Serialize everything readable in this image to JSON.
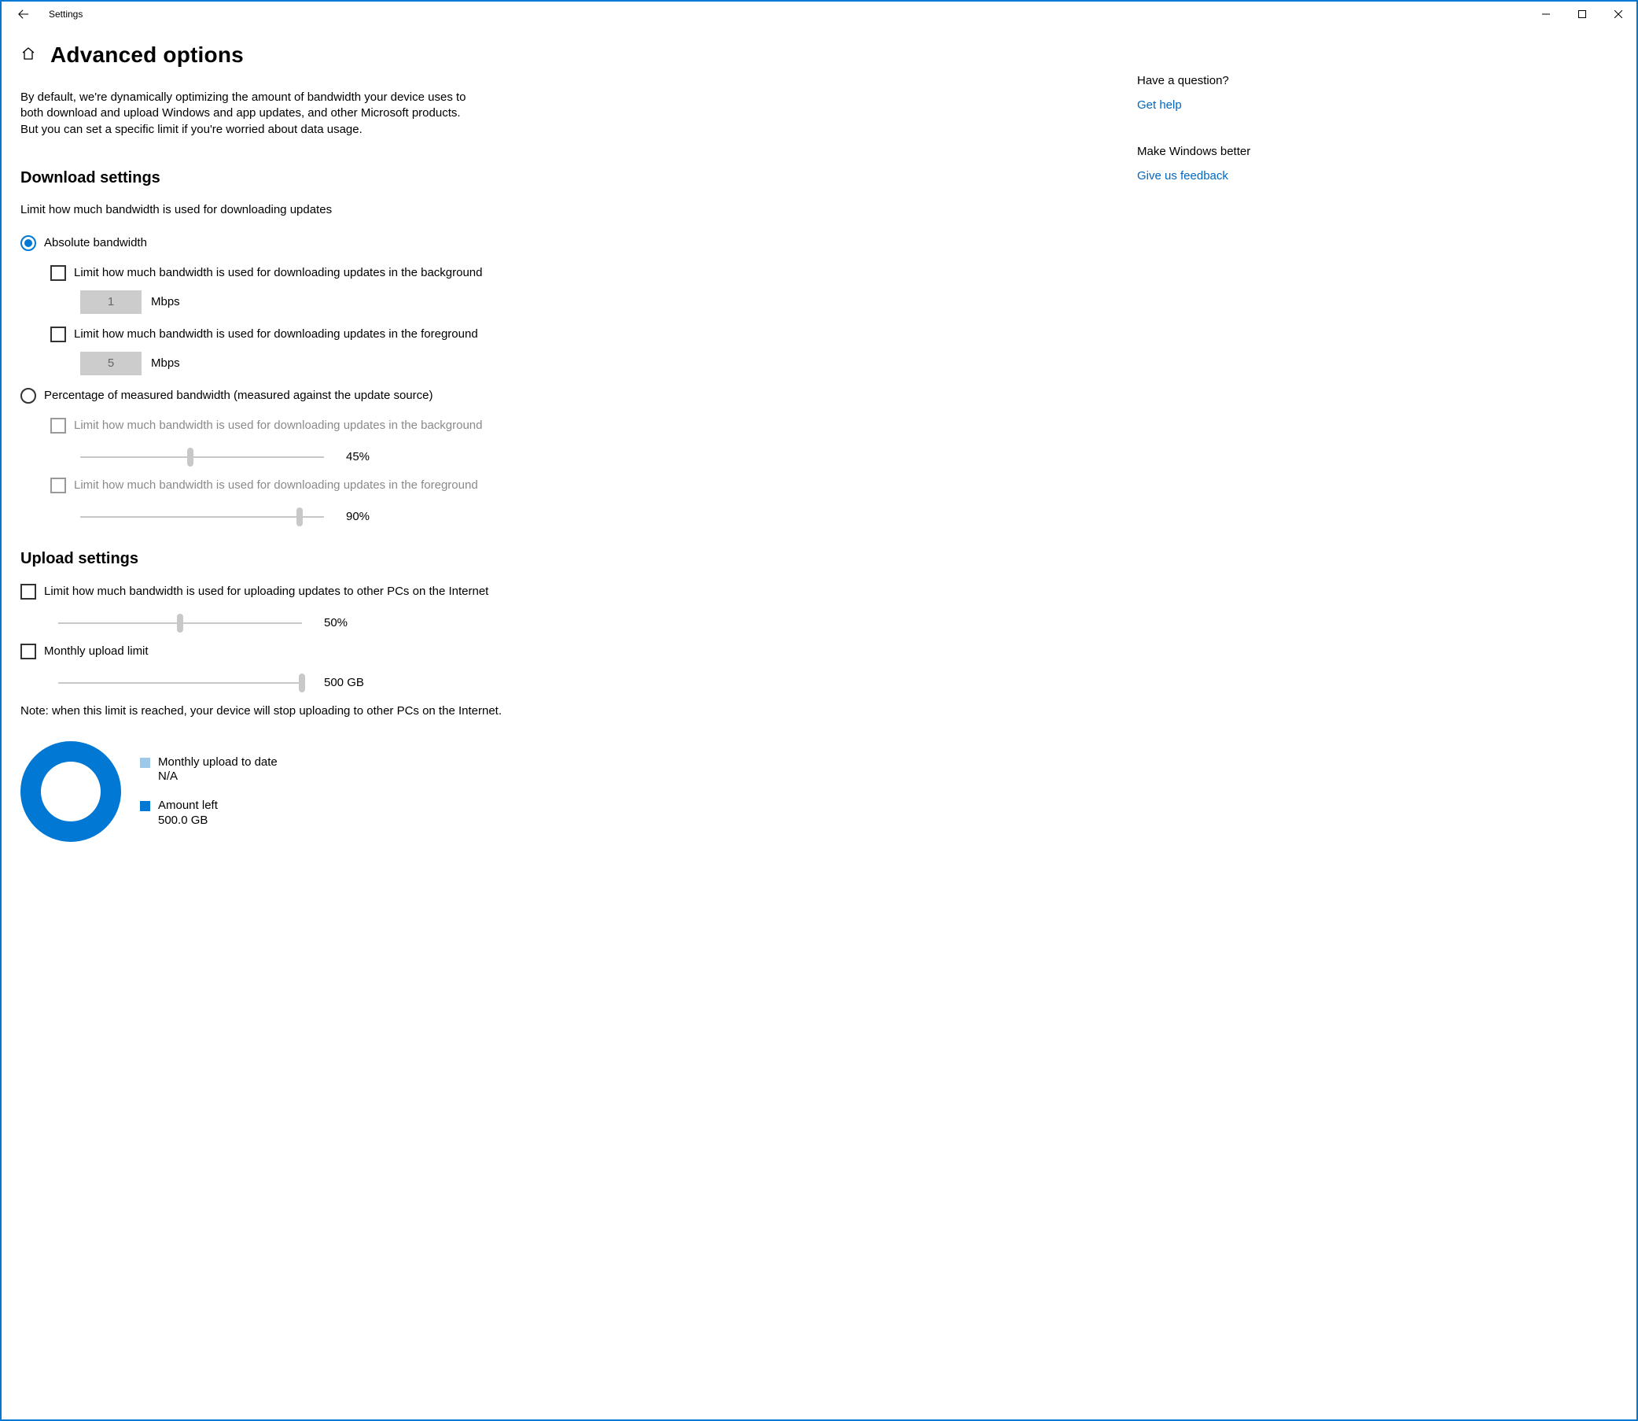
{
  "window": {
    "title": "Settings"
  },
  "header": {
    "title": "Advanced options"
  },
  "intro": "By default, we're dynamically optimizing the amount of bandwidth your device uses to both download and upload Windows and app updates, and other Microsoft products. But you can set a specific limit if you're worried about data usage.",
  "download": {
    "heading": "Download settings",
    "desc": "Limit how much bandwidth is used for downloading updates",
    "absolute": {
      "label": "Absolute bandwidth",
      "bg": {
        "label": "Limit how much bandwidth is used for downloading updates in the background",
        "value": "1",
        "unit": "Mbps"
      },
      "fg": {
        "label": "Limit how much bandwidth is used for downloading updates in the foreground",
        "value": "5",
        "unit": "Mbps"
      }
    },
    "percent": {
      "label": "Percentage of measured bandwidth (measured against the update source)",
      "bg": {
        "label": "Limit how much bandwidth is used for downloading updates in the background",
        "value": "45%",
        "pct": 45
      },
      "fg": {
        "label": "Limit how much bandwidth is used for downloading updates in the foreground",
        "value": "90%",
        "pct": 90
      }
    }
  },
  "upload": {
    "heading": "Upload settings",
    "bw": {
      "label": "Limit how much bandwidth is used for uploading updates to other PCs on the Internet",
      "value": "50%",
      "pct": 50
    },
    "monthly": {
      "label": "Monthly upload limit",
      "value": "500 GB",
      "pct": 100
    },
    "note": "Note: when this limit is reached, your device will stop uploading to other PCs on the Internet.",
    "legend": {
      "todate_label": "Monthly upload to date",
      "todate_value": "N/A",
      "left_label": "Amount left",
      "left_value": "500.0 GB"
    }
  },
  "side": {
    "question": "Have a question?",
    "gethelp": "Get help",
    "better": "Make Windows better",
    "feedback": "Give us feedback"
  }
}
